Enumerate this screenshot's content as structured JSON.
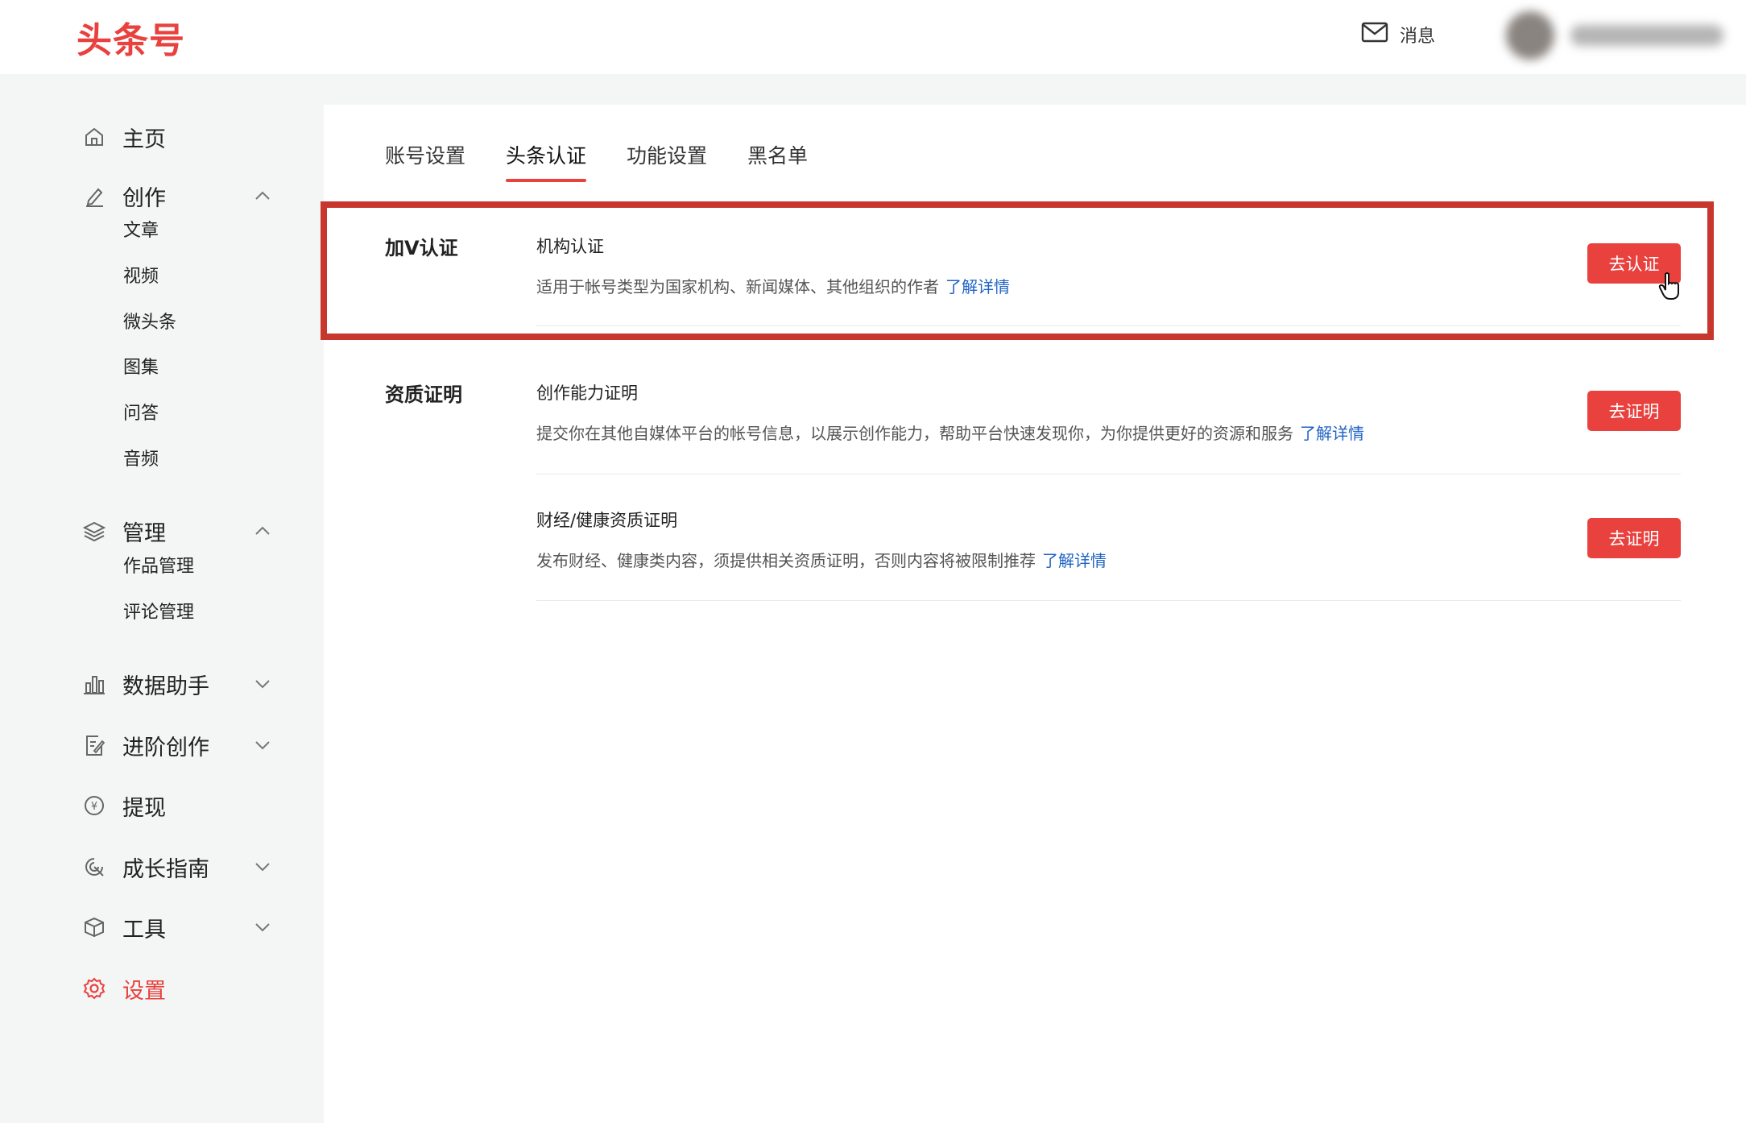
{
  "header": {
    "logo": "头条号",
    "messages_label": "消息"
  },
  "sidebar": {
    "items": [
      {
        "label": "主页",
        "icon": "home-icon"
      },
      {
        "label": "创作",
        "icon": "pen-icon",
        "expanded": true,
        "children": [
          "文章",
          "视频",
          "微头条",
          "图集",
          "问答",
          "音频"
        ]
      },
      {
        "label": "管理",
        "icon": "layers-icon",
        "expanded": true,
        "children": [
          "作品管理",
          "评论管理"
        ]
      },
      {
        "label": "数据助手",
        "icon": "bar-chart-icon",
        "expanded": false
      },
      {
        "label": "进阶创作",
        "icon": "edit-doc-icon",
        "expanded": false
      },
      {
        "label": "提现",
        "icon": "yuan-coin-icon"
      },
      {
        "label": "成长指南",
        "icon": "growth-icon",
        "expanded": false
      },
      {
        "label": "工具",
        "icon": "cube-icon",
        "expanded": false
      },
      {
        "label": "设置",
        "icon": "gear-icon",
        "active": true
      }
    ]
  },
  "tabs": [
    "账号设置",
    "头条认证",
    "功能设置",
    "黑名单"
  ],
  "active_tab": "头条认证",
  "sections": {
    "v_cert": {
      "title": "加V认证",
      "item": {
        "title": "机构认证",
        "desc": "适用于帐号类型为国家机构、新闻媒体、其他组织的作者",
        "link": "了解详情",
        "button": "去认证"
      }
    },
    "qualification": {
      "title": "资质证明",
      "items": [
        {
          "title": "创作能力证明",
          "desc": "提交你在其他自媒体平台的帐号信息，以展示创作能力，帮助平台快速发现你，为你提供更好的资源和服务",
          "link": "了解详情",
          "button": "去证明"
        },
        {
          "title": "财经/健康资质证明",
          "desc": "发布财经、健康类内容，须提供相关资质证明，否则内容将被限制推荐",
          "link": "了解详情",
          "button": "去证明"
        }
      ]
    }
  },
  "colors": {
    "brand_red": "#e8413e",
    "highlight_border": "#c8372d",
    "link_blue": "#1f63c4"
  }
}
